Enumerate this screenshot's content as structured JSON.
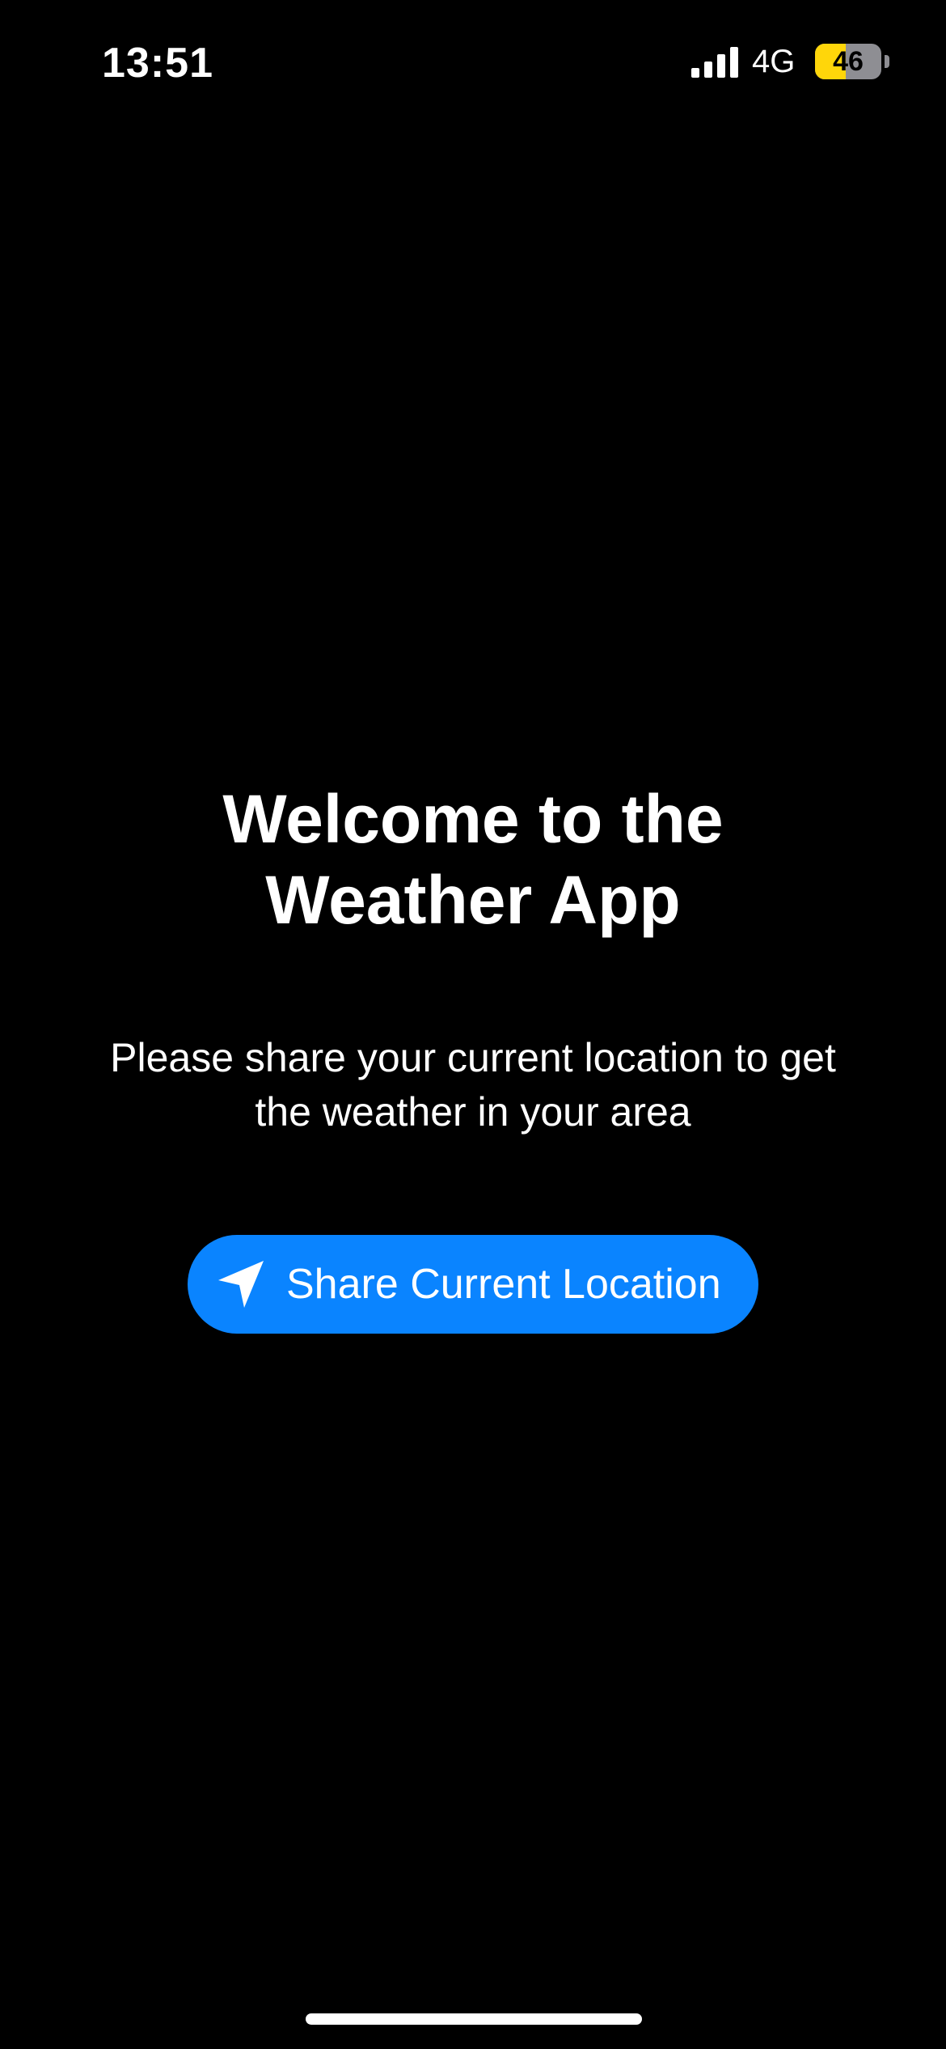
{
  "status_bar": {
    "time": "13:51",
    "network": "4G",
    "battery_level": "46",
    "battery_percent": 46,
    "battery_color": "#ffd60a",
    "signal_icon": "cellular-signal-icon"
  },
  "welcome": {
    "title_lines": [
      "Welcome to the",
      "Weather App"
    ],
    "message_lines": [
      "Please share your current location to get",
      "the weather in your area"
    ]
  },
  "share_button": {
    "label": "Share Current Location",
    "icon": "location-arrow-icon",
    "color": "#0a84ff"
  },
  "colors": {
    "background": "#000000",
    "text": "#ffffff"
  }
}
